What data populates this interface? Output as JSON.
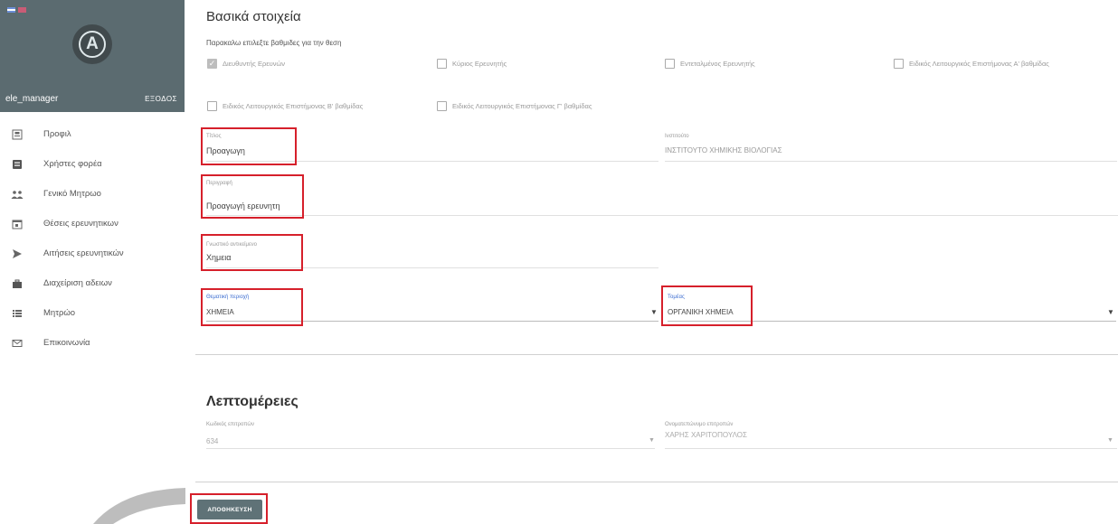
{
  "sidebar": {
    "username": "ele_manager",
    "logout_label": "ΕΞΟΔΟΣ",
    "logo_letter": "A",
    "items": [
      {
        "label": "Προφιλ",
        "icon": "profile-icon"
      },
      {
        "label": "Χρήστες φορέα",
        "icon": "users-icon"
      },
      {
        "label": "Γενικό Μητρωο",
        "icon": "group-icon"
      },
      {
        "label": "Θέσεις ερευνητικων",
        "icon": "calendar-icon"
      },
      {
        "label": "Αιτήσεις ερευνητικών",
        "icon": "send-icon"
      },
      {
        "label": "Διαχείριση αδειων",
        "icon": "briefcase-icon"
      },
      {
        "label": "Μητρώο",
        "icon": "list-icon"
      },
      {
        "label": "Επικοινωνία",
        "icon": "mail-icon"
      }
    ]
  },
  "basic": {
    "title": "Βασικά στοιχεία",
    "hint": "Παρακαλω επιλεξτε βαθμιδες για την θεση",
    "grades": [
      {
        "label": "Διευθυντής Ερευνών",
        "checked": true
      },
      {
        "label": "Κύριος Ερευνητής",
        "checked": false
      },
      {
        "label": "Εντεταλμένος Ερευνητής",
        "checked": false
      },
      {
        "label": "Ειδικός Λειτουργικός Επιστήμονας Α' βαθμίδας",
        "checked": false
      },
      {
        "label": "Ειδικός Λειτουργικός Επιστήμονας Β' βαθμίδας",
        "checked": false
      },
      {
        "label": "Ειδικός Λειτουργικός Επιστήμονας Γ' βαθμίδας",
        "checked": false
      }
    ],
    "title_field": {
      "label": "Τίτλος",
      "value": "Προαγωγη"
    },
    "institute_field": {
      "label": "Ινστιτούτο",
      "value": "ΙΝΣΤΙΤΟΥΤΟ ΧΗΜΙΚΗΣ ΒΙΟΛΟΓΙΑΣ"
    },
    "description_field": {
      "label": "Περιγραφή",
      "value": "Προαγωγή ερευνητη"
    },
    "scientific_field": {
      "label": "Γνωστικό αντικείμενο",
      "value": "Χημεια"
    },
    "thematic_area": {
      "label": "Θεματική περιοχή",
      "value": "ΧΗΜΕΙΑ"
    },
    "sector": {
      "label": "Τομέας",
      "value": "ΟΡΓΑΝΙΚΗ ΧΗΜΕΙΑ"
    }
  },
  "details": {
    "title": "Λεπτομέρειες",
    "code_field": {
      "label": "Κωδικός επιτροπών",
      "value": "634"
    },
    "committee_field": {
      "label": "Ονοματεπώνυμο επιτροπών",
      "value": "ΧΑΡΗΣ ΧΑΡΙΤΟΠΟΥΛΟΣ"
    }
  },
  "actions": {
    "save_label": "ΑΠΟΘΗΚΕΥΣΗ"
  },
  "colors": {
    "highlight": "#d6202b",
    "sidebar_header": "#5b6b70",
    "accent": "#3f6fd1"
  }
}
